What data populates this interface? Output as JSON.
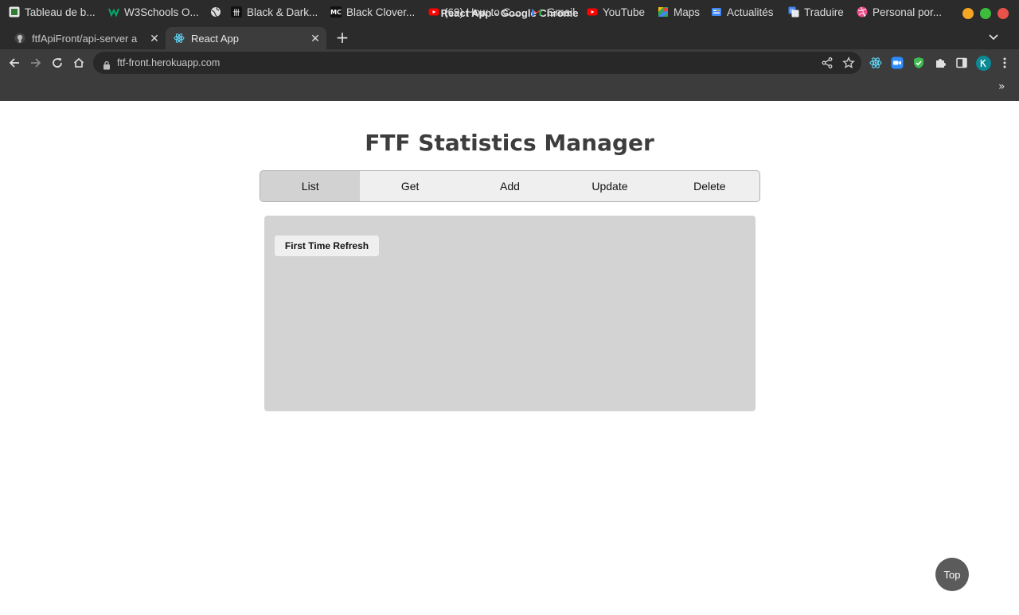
{
  "window": {
    "title": "React App - Google Chrome",
    "controls": {
      "minimize_color": "#f5a623",
      "maximize_color": "#3ebc3e",
      "close_color": "#e9514b"
    }
  },
  "tabs": [
    {
      "title": "ftfApiFront/api-server a",
      "icon": "github-icon",
      "active": false
    },
    {
      "title": "React App",
      "icon": "react-icon",
      "active": true
    }
  ],
  "toolbar": {
    "url": "ftf-front.herokuapp.com"
  },
  "bookmarks": [
    {
      "label": "Tableau de b...",
      "icon": "dashboard-icon"
    },
    {
      "label": "W3Schools O...",
      "icon": "w3schools-icon"
    },
    {
      "label": "",
      "icon": "globe-icon"
    },
    {
      "label": "Black & Dark...",
      "icon": "manga-icon"
    },
    {
      "label": "Black Clover...",
      "icon": "manga-icon"
    },
    {
      "label": "(69) How to C...",
      "icon": "youtube-icon"
    },
    {
      "label": "Gmail",
      "icon": "gmail-icon"
    },
    {
      "label": "YouTube",
      "icon": "youtube-icon"
    },
    {
      "label": "Maps",
      "icon": "maps-icon"
    },
    {
      "label": "Actualités",
      "icon": "news-icon"
    },
    {
      "label": "Traduire",
      "icon": "translate-icon"
    },
    {
      "label": "Personal por...",
      "icon": "dribbble-icon"
    }
  ],
  "page": {
    "title": "FTF Statistics Manager",
    "nav": [
      "List",
      "Get",
      "Add",
      "Update",
      "Delete"
    ],
    "selected_nav": "List",
    "refresh_button": "First Time Refresh",
    "top_button": "Top"
  },
  "colors": {
    "panel_bg": "#d3d3d3",
    "selected_tab_bg": "#d2d2d2",
    "top_button_bg": "#5b5b5b"
  }
}
